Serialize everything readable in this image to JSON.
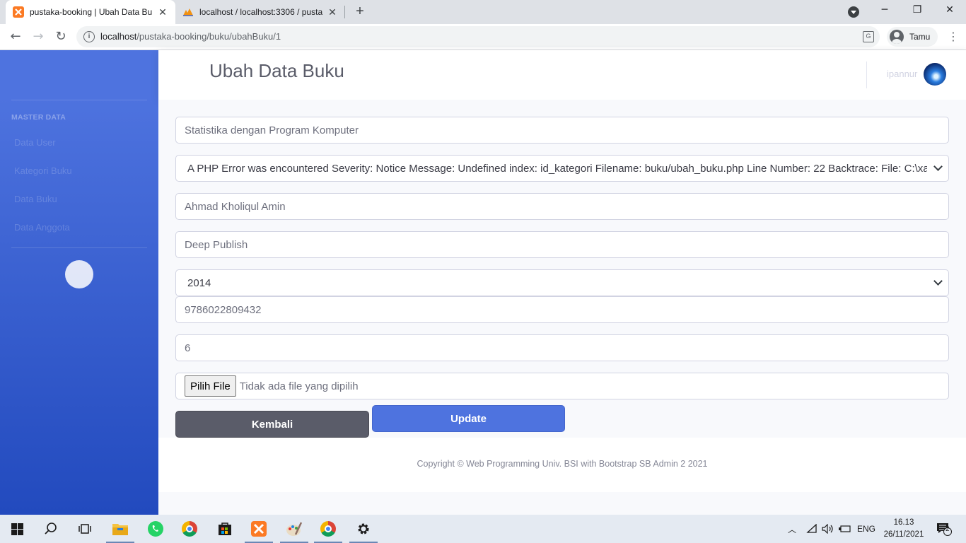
{
  "browser": {
    "tabs": [
      {
        "title": "pustaka-booking | Ubah Data Buku",
        "active": true
      },
      {
        "title": "localhost / localhost:3306 / pustaka",
        "active": false
      }
    ],
    "new_tab": "+",
    "url_host": "localhost",
    "url_path": "/pustaka-booking/buku/ubahBuku/1",
    "profile_label": "Tamu",
    "window_controls": {
      "minimize": "─",
      "maximize": "❐",
      "close": "✕"
    },
    "nav": {
      "back": "←",
      "forward": "→",
      "reload": "↻"
    }
  },
  "sidebar": {
    "heading": "MASTER DATA",
    "items": [
      {
        "label": "Data User"
      },
      {
        "label": "Kategori Buku"
      },
      {
        "label": "Data Buku"
      },
      {
        "label": "Data Anggota"
      }
    ],
    "toggle_glyph": ""
  },
  "topbar": {
    "page_title": "Ubah Data Buku",
    "username": "ipannur"
  },
  "form": {
    "judul": "Statistika dengan Program Komputer",
    "kategori": "A PHP Error was encountered Severity: Notice Message: Undefined index: id_kategori Filename: buku/ubah_buku.php Line Number: 22 Backtrace: File: C:\\xampp\\htdocs",
    "pengarang": "Ahmad Kholiqul Amin",
    "penerbit": "Deep Publish",
    "tahun": "2014",
    "isbn": "9786022809432",
    "stok": "6",
    "file_button": "Pilih File",
    "file_status": "Tidak ada file yang dipilih",
    "back_label": "Kembali",
    "update_label": "Update"
  },
  "footer": {
    "copyright": "Copyright © Web Programming Univ. BSI with Bootstrap SB Admin 2 2021"
  },
  "taskbar": {
    "language": "ENG",
    "time": "16.13",
    "date": "26/11/2021",
    "notification_count": "2"
  },
  "colors": {
    "sidebar_top": "#4e73df",
    "sidebar_bottom": "#224abe",
    "primary_button": "#4e73df",
    "secondary_button": "#5a5c69"
  }
}
